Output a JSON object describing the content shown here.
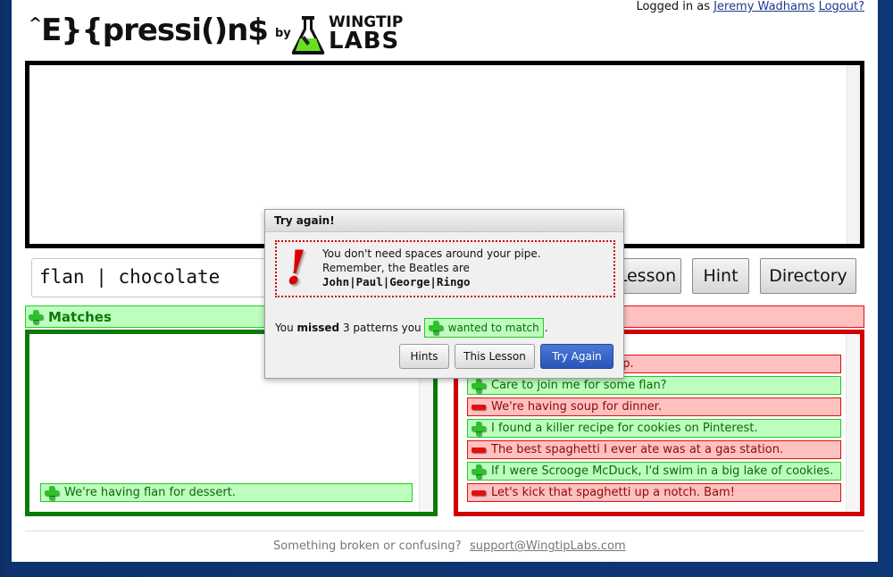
{
  "header": {
    "logo_text": "E}{pressi()n$",
    "logo_caret": "^",
    "by_label": "by",
    "brand_line1": "WINGTIP",
    "brand_line2": "LABS",
    "logged_in_prefix": "Logged in as",
    "user_name": "Jeremy Wadhams",
    "logout_label": "Logout?"
  },
  "editor": {
    "content": ""
  },
  "regex_input": {
    "value": "flan | chocolate"
  },
  "toolbar": {
    "lesson_label": "This Lesson",
    "hint_label": "Hint",
    "directory_label": "Directory"
  },
  "matches_panel": {
    "title": "Matches",
    "items": [
      {
        "text": "We're having flan for dessert.",
        "type": "wanted"
      }
    ]
  },
  "nonmatches_panel": {
    "title": "",
    "items": [
      {
        "text": "There's a fly in my soup.",
        "type": "unwanted"
      },
      {
        "text": "Care to join me for some flan?",
        "type": "wanted"
      },
      {
        "text": "We're having soup for dinner.",
        "type": "unwanted"
      },
      {
        "text": "I found a killer recipe for cookies on Pinterest.",
        "type": "wanted"
      },
      {
        "text": "The best spaghetti I ever ate was at a gas station.",
        "type": "unwanted"
      },
      {
        "text": "If I were Scrooge McDuck, I'd swim in a big lake of cookies.",
        "type": "wanted"
      },
      {
        "text": "Let's kick that spaghetti up a notch.  Bam!",
        "type": "unwanted"
      }
    ]
  },
  "dialog": {
    "title": "Try again!",
    "hint_line1": "You don't need spaces around your pipe.",
    "hint_line2": "Remember, the Beatles are",
    "hint_code": "John|Paul|George|Ringo",
    "missed_prefix": "You",
    "missed_bold": "missed",
    "missed_middle": "3 patterns you",
    "missed_chip": "wanted to match",
    "missed_suffix": ".",
    "buttons": {
      "hints": "Hints",
      "lesson": "This Lesson",
      "try_again": "Try Again"
    }
  },
  "footer": {
    "text": "Something broken or confusing?",
    "support_link": "support@WingtipLabs.com"
  },
  "colors": {
    "good_bg": "#bdfdbd",
    "good_border": "#22cc22",
    "bad_bg": "#ffc0c0",
    "bad_border": "#e01010",
    "matches_frame": "#0b7a0b",
    "nonmatches_frame": "#d00000",
    "primary_button": "#2a55b8",
    "background": "#0f3775"
  }
}
